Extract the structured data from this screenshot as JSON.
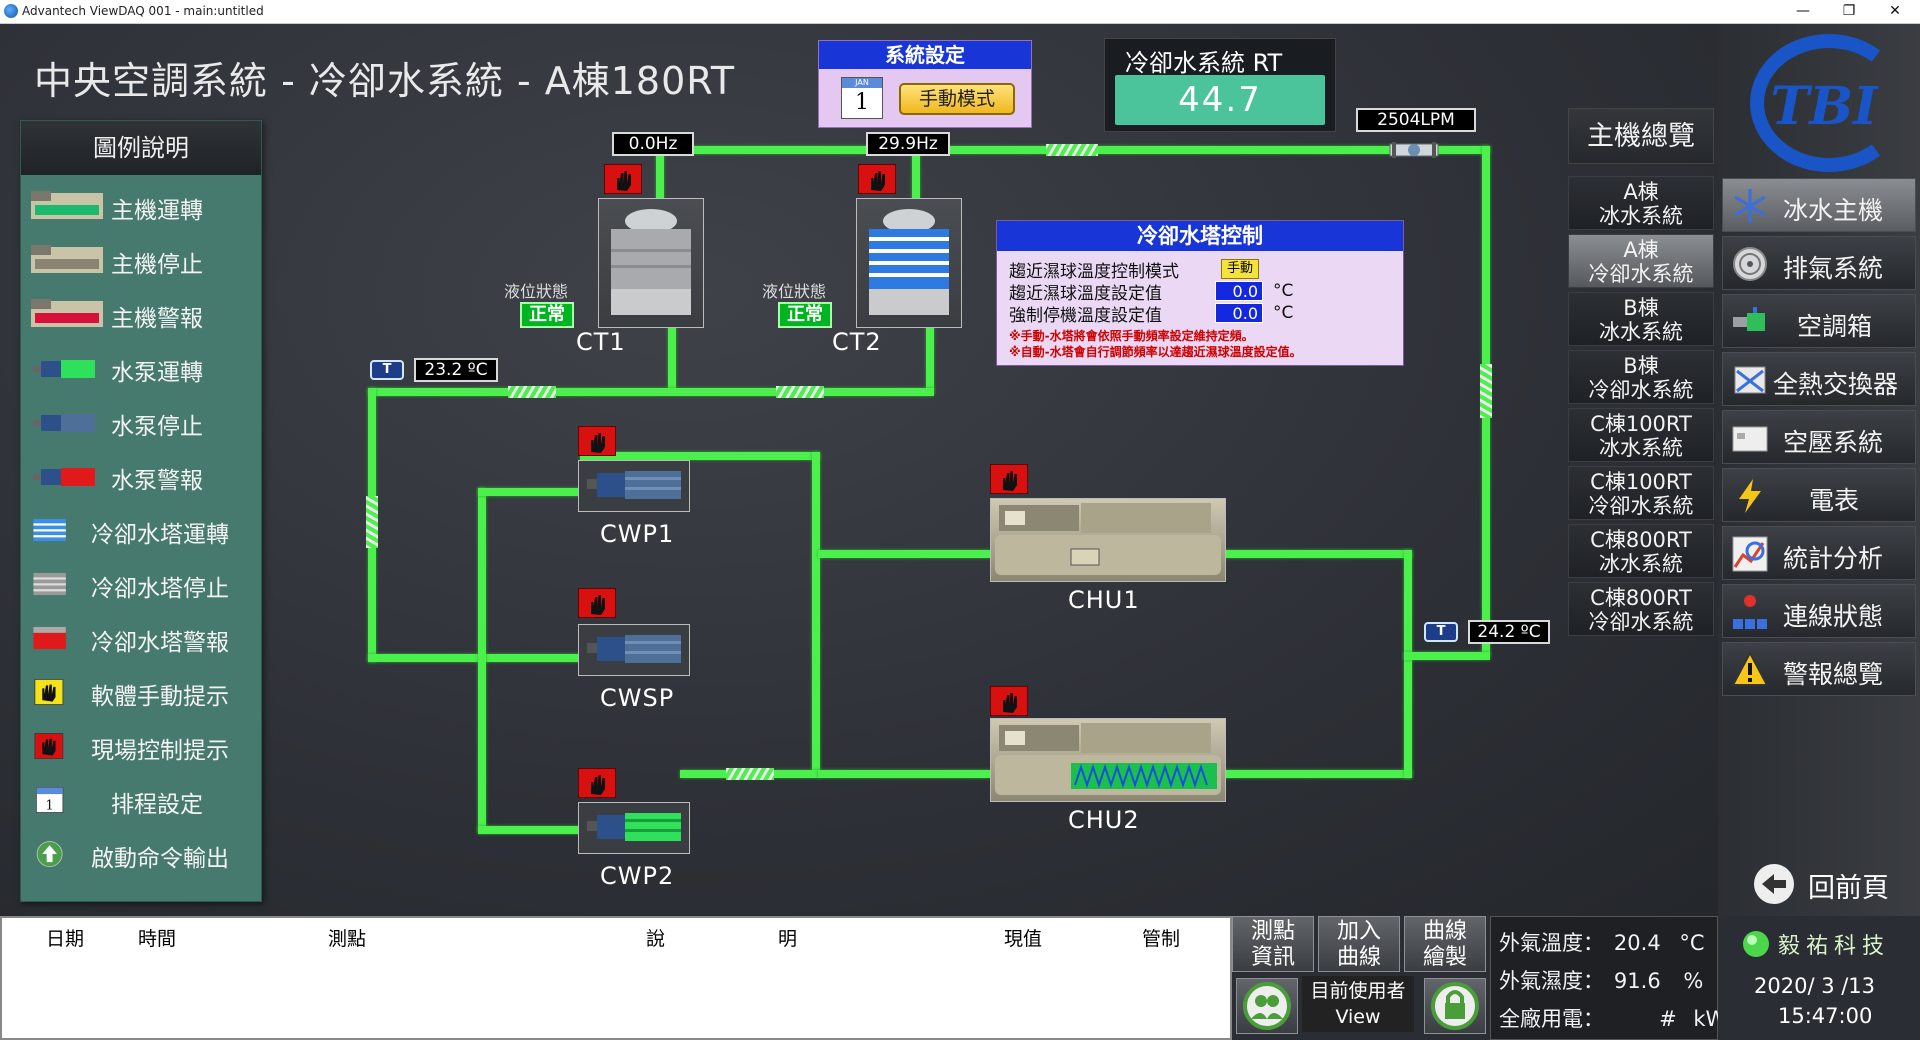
{
  "window": {
    "title": "Advantech ViewDAQ 001 - main:untitled",
    "min": "—",
    "max": "❐",
    "close": "✕"
  },
  "page_title": "中央空調系統 - 冷卻水系統 - A棟180RT",
  "legend": {
    "title": "圖例說明",
    "items": [
      "主機運轉",
      "主機停止",
      "主機警報",
      "水泵運轉",
      "水泵停止",
      "水泵警報",
      "冷卻水塔運轉",
      "冷卻水塔停止",
      "冷卻水塔警報",
      "軟體手動提示",
      "現場控制提示",
      "排程設定",
      "啟動命令輸出"
    ]
  },
  "system_setting": {
    "title": "系統設定",
    "mode_button": "手動模式",
    "calendar_day": "1",
    "calendar_month": "JAN"
  },
  "rt_panel": {
    "label": "冷卻水系統 RT",
    "value": "44.7"
  },
  "readouts": {
    "ct1_freq": "0.0Hz",
    "ct2_freq": "29.9Hz",
    "flow": "2504LPM",
    "temp_left": "23.2 ºC",
    "temp_right": "24.2 ºC"
  },
  "sensor_tag": "T",
  "cooling_towers": {
    "level_label": "液位狀態",
    "ct1": {
      "name": "CT1",
      "level": "正常"
    },
    "ct2": {
      "name": "CT2",
      "level": "正常"
    }
  },
  "pumps": {
    "cwp1": "CWP1",
    "cwsp": "CWSP",
    "cwp2": "CWP2"
  },
  "chillers": {
    "chu1": "CHU1",
    "chu2": "CHU2"
  },
  "ct_control": {
    "title": "冷卻水塔控制",
    "row1_label": "趨近濕球溫度控制模式",
    "row1_mode": "手動",
    "row2_label": "趨近濕球溫度設定值",
    "row2_value": "0.0",
    "row3_label": "強制停機溫度設定值",
    "row3_value": "0.0",
    "unit": "°C",
    "note1": "※手動-水塔將會依照手動頻率設定維持定頻。",
    "note2": "※自動-水塔會自行調節頻率以達趨近濕球溫度設定值。"
  },
  "nav_overview": {
    "title": "主機總覽",
    "items": [
      {
        "line1": "A棟",
        "line2": "冰水系統"
      },
      {
        "line1": "A棟",
        "line2": "冷卻水系統"
      },
      {
        "line1": "B棟",
        "line2": "冰水系統"
      },
      {
        "line1": "B棟",
        "line2": "冷卻水系統"
      },
      {
        "line1": "C棟100RT",
        "line2": "冰水系統"
      },
      {
        "line1": "C棟100RT",
        "line2": "冷卻水系統"
      },
      {
        "line1": "C棟800RT",
        "line2": "冰水系統"
      },
      {
        "line1": "C棟800RT",
        "line2": "冷卻水系統"
      }
    ]
  },
  "logo_text": "TBI",
  "nav_systems": [
    "冰水主機",
    "排氣系統",
    "空調箱",
    "全熱交換器",
    "空壓系統",
    "電表",
    "統計分析",
    "連線狀態",
    "警報總覽"
  ],
  "back_button": "回前頁",
  "event_table": {
    "headers": [
      "日期",
      "時間",
      "測點",
      "說",
      "明",
      "現值",
      "管制"
    ]
  },
  "tools": {
    "point_info": {
      "line1": "測點",
      "line2": "資訊"
    },
    "add_curve": {
      "line1": "加入",
      "line2": "曲線"
    },
    "draw_curve": {
      "line1": "曲線",
      "line2": "繪製"
    },
    "user_label": "目前使用者",
    "user_name": "View"
  },
  "environment": {
    "outdoor_temp_label": "外氣溫度：",
    "outdoor_temp_value": "20.4",
    "outdoor_temp_unit": "°C",
    "outdoor_hum_label": "外氣濕度：",
    "outdoor_hum_value": "91.6",
    "outdoor_hum_unit": "%",
    "power_label": "全廠用電：",
    "power_value": "#",
    "power_unit": "kW"
  },
  "clock": {
    "brand": "毅祐科技",
    "date": "2020/ 3 /13",
    "time": "15:47:00"
  },
  "colors": {
    "pipe": "#4cf04c",
    "accent_blue": "#1836d8",
    "legend_bg": "#477a6e",
    "alarm_red": "#d81010"
  }
}
